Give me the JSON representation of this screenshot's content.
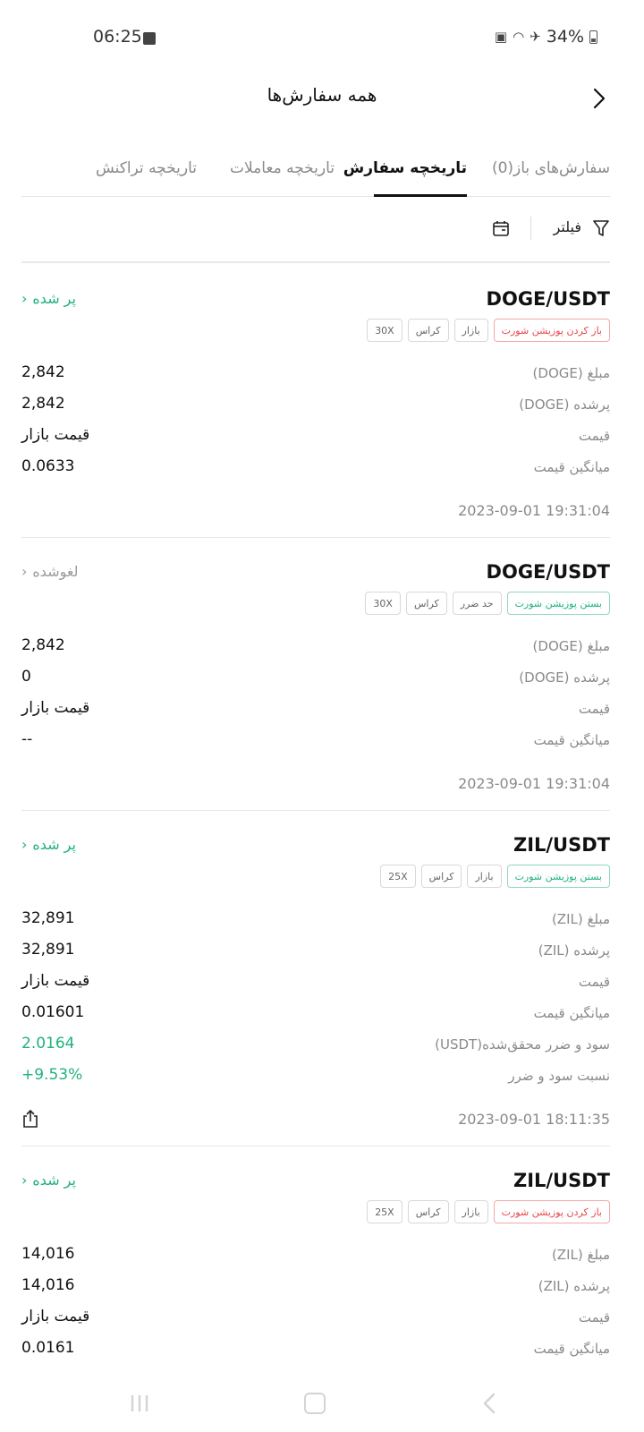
{
  "status_bar": {
    "time": "06:25",
    "battery": "34%"
  },
  "header": {
    "title": "همه سفارش‌ها"
  },
  "tabs": [
    {
      "label": "سفارش‌های باز(0)"
    },
    {
      "label": "تاریخچه سفارش"
    },
    {
      "label": "تاریخچه معاملات"
    },
    {
      "label": "تاریخچه تراکنش"
    }
  ],
  "active_tab": 1,
  "filter": {
    "label": "فیلتر"
  },
  "orders": [
    {
      "pair": "DOGE/USDT",
      "status": "پر شده",
      "tags": [
        "باز کردن پوزیشن شورت",
        "بازار",
        "کراس",
        "30X"
      ],
      "rows": [
        {
          "label": "مبلغ (DOGE)",
          "value": "2,842"
        },
        {
          "label": "پرشده (DOGE)",
          "value": "2,842"
        },
        {
          "label": "قیمت",
          "value": "قیمت بازار"
        },
        {
          "label": "میانگین قیمت",
          "value": "0.0633"
        }
      ],
      "time": "2023-09-01 19:31:04"
    },
    {
      "pair": "DOGE/USDT",
      "status": "لغوشده",
      "tags": [
        "بستن پوزیشن شورت",
        "حد ضرر",
        "کراس",
        "30X"
      ],
      "rows": [
        {
          "label": "مبلغ (DOGE)",
          "value": "2,842"
        },
        {
          "label": "پرشده (DOGE)",
          "value": "0"
        },
        {
          "label": "قیمت",
          "value": "قیمت بازار"
        },
        {
          "label": "میانگین قیمت",
          "value": "--"
        }
      ],
      "time": "2023-09-01 19:31:04"
    },
    {
      "pair": "ZIL/USDT",
      "status": "پر شده",
      "tags": [
        "بستن پوزیشن شورت",
        "بازار",
        "کراس",
        "25X"
      ],
      "rows": [
        {
          "label": "مبلغ (ZIL)",
          "value": "32,891"
        },
        {
          "label": "پرشده (ZIL)",
          "value": "32,891"
        },
        {
          "label": "قیمت",
          "value": "قیمت بازار"
        },
        {
          "label": "میانگین قیمت",
          "value": "0.01601"
        },
        {
          "label": "سود و ضرر محقق‌شده(USDT)",
          "value": "2.0164"
        },
        {
          "label": "نسبت سود و ضرر",
          "value": "+9.53%"
        }
      ],
      "time": "2023-09-01 18:11:35"
    },
    {
      "pair": "ZIL/USDT",
      "status": "پر شده",
      "tags": [
        "باز کردن پوزیشن شورت",
        "بازار",
        "کراس",
        "25X"
      ],
      "rows": [
        {
          "label": "مبلغ (ZIL)",
          "value": "14,016"
        },
        {
          "label": "پرشده (ZIL)",
          "value": "14,016"
        },
        {
          "label": "قیمت",
          "value": "قیمت بازار"
        },
        {
          "label": "میانگین قیمت",
          "value": "0.0161"
        }
      ],
      "time": ""
    }
  ],
  "colors": {
    "green": "#20b27a",
    "red": "#e5484d",
    "muted": "#8a8a8a",
    "text": "#111111"
  }
}
